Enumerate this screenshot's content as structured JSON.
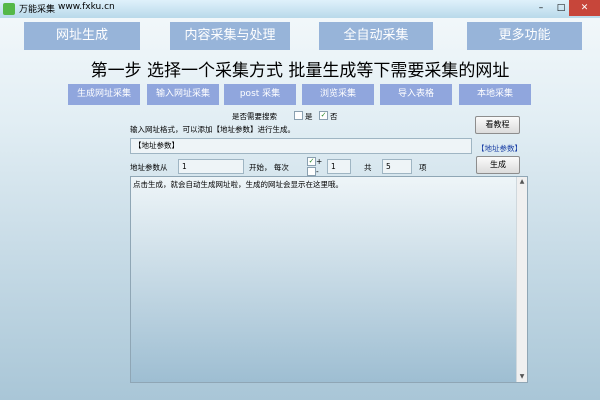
{
  "window": {
    "title": "万能采集",
    "url": "www.fxku.cn",
    "minimize": "–",
    "maximize": "□",
    "close": "✕"
  },
  "nav": {
    "tabs": [
      "网址生成",
      "内容采集与处理",
      "全自动采集",
      "更多功能"
    ]
  },
  "step_title": "第一步  选择一个采集方式  批量生成等下需要采集的网址",
  "methods": [
    "生成网址采集",
    "输入网址采集",
    "post 采集",
    "浏览采集",
    "导入表格",
    "本地采集"
  ],
  "search": {
    "question": "是否需要搜索",
    "yes": "是",
    "no": "否",
    "yes_checked": "",
    "no_checked": "✓"
  },
  "tutorial_button": "看教程",
  "format_hint": "输入网址格式，可以添加【地址参数】进行生成。",
  "url_template_value": "【地址参数】",
  "param_link": "【地址参数】",
  "params": {
    "from_label": "地址参数从",
    "from_value": "1",
    "step_label": "开始， 每次",
    "plus": "+",
    "minus": "-",
    "plus_checked": "✓",
    "step_value": "1",
    "total_label": "共",
    "total_value": "5",
    "unit": "项"
  },
  "generate_button": "生成",
  "output_text": "点击生成，就会自动生成网址啦，生成的网址会显示在这里哦。",
  "scroll": {
    "up": "▲",
    "down": "▼"
  }
}
